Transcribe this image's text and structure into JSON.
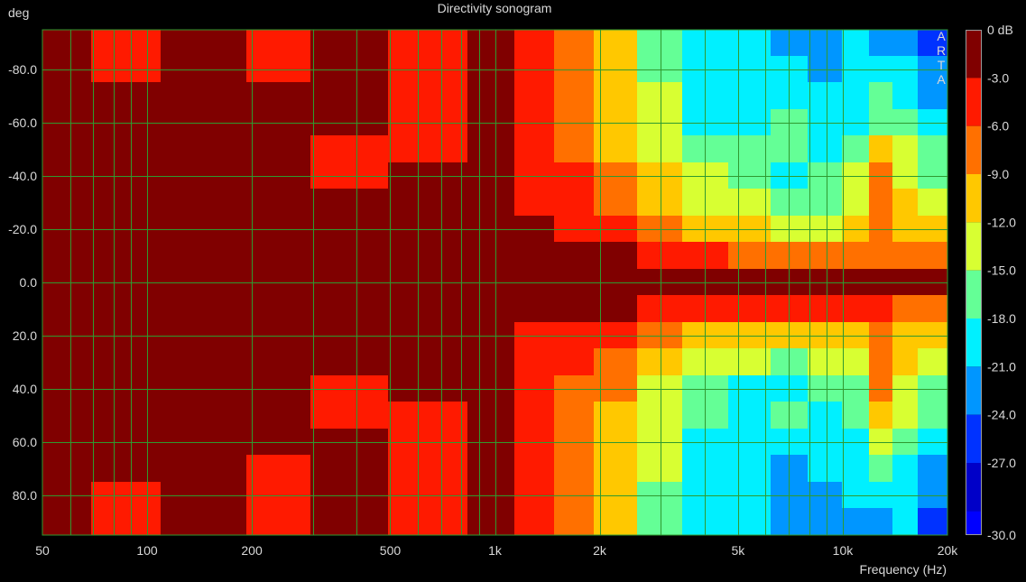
{
  "chart_data": {
    "type": "heatmap",
    "title": "Directivity sonogram",
    "ylabel": "deg",
    "xlabel": "Frequency (Hz)",
    "watermark": "ARTA",
    "x_scale": "log",
    "xlim": [
      50,
      20000
    ],
    "ylim": [
      -95,
      95
    ],
    "y_inverted": true,
    "grid": true,
    "x_ticks": [
      {
        "value": 50,
        "label": "50"
      },
      {
        "value": 100,
        "label": "100"
      },
      {
        "value": 200,
        "label": "200"
      },
      {
        "value": 500,
        "label": "500"
      },
      {
        "value": 1000,
        "label": "1k"
      },
      {
        "value": 2000,
        "label": "2k"
      },
      {
        "value": 5000,
        "label": "5k"
      },
      {
        "value": 10000,
        "label": "10k"
      },
      {
        "value": 20000,
        "label": "20k"
      }
    ],
    "y_ticks": [
      {
        "value": -80,
        "label": "-80.0"
      },
      {
        "value": -60,
        "label": "-60.0"
      },
      {
        "value": -40,
        "label": "-40.0"
      },
      {
        "value": -20,
        "label": "-20.0"
      },
      {
        "value": 0,
        "label": "0.0"
      },
      {
        "value": 20,
        "label": "20.0"
      },
      {
        "value": 40,
        "label": "40.0"
      },
      {
        "value": 60,
        "label": "60.0"
      },
      {
        "value": 80,
        "label": "80.0"
      }
    ],
    "colorbar": {
      "position": "right",
      "levels": [
        {
          "label": "0 dB",
          "from": 0,
          "to": -3,
          "color": "#800000"
        },
        {
          "label": "-3.0",
          "from": -3,
          "to": -6,
          "color": "#ff1a00"
        },
        {
          "label": "-6.0",
          "from": -6,
          "to": -9,
          "color": "#ff7000"
        },
        {
          "label": "-9.0",
          "from": -9,
          "to": -12,
          "color": "#ffc800"
        },
        {
          "label": "-12.0",
          "from": -12,
          "to": -15,
          "color": "#d8ff32"
        },
        {
          "label": "-15.0",
          "from": -15,
          "to": -18,
          "color": "#64ff96"
        },
        {
          "label": "-18.0",
          "from": -18,
          "to": -21,
          "color": "#00f0ff"
        },
        {
          "label": "-21.0",
          "from": -21,
          "to": -24,
          "color": "#0096ff"
        },
        {
          "label": "-24.0",
          "from": -24,
          "to": -27,
          "color": "#0032ff"
        },
        {
          "label": "-27.0",
          "from": -27,
          "to": -30,
          "color": "#0000c8"
        },
        {
          "label": "-30.0",
          "from": -30,
          "to": -33,
          "color": "#0000ff"
        }
      ]
    },
    "angles": [
      -90,
      -80,
      -70,
      -60,
      -50,
      -40,
      -30,
      -20,
      -10,
      0,
      10,
      20,
      30,
      40,
      50,
      60,
      70,
      80,
      90
    ],
    "frequencies": [
      60,
      80,
      150,
      250,
      350,
      700,
      1000,
      1300,
      1700,
      2200,
      3000,
      4000,
      5500,
      7000,
      9000,
      11000,
      13000,
      15000,
      18000
    ],
    "levels_db": [
      [
        -2,
        -4,
        -1,
        -4,
        -1,
        -4,
        -2,
        -4,
        -7,
        -10,
        -15,
        -20,
        -20,
        -21,
        -23,
        -20,
        -22,
        -21,
        -24
      ],
      [
        -2,
        -4,
        -1,
        -4,
        -1,
        -4,
        -2,
        -4,
        -7,
        -10,
        -15,
        -19,
        -19,
        -20,
        -22,
        -20,
        -19,
        -20,
        -23
      ],
      [
        -1,
        -1,
        -1,
        -1,
        -1,
        -4,
        -2,
        -4,
        -7,
        -10,
        -14,
        -19,
        -19,
        -19,
        -20,
        -19,
        -17,
        -19,
        -21
      ],
      [
        -1,
        -1,
        -1,
        -1,
        -1,
        -4,
        -2,
        -4,
        -7,
        -10,
        -14,
        -18,
        -18,
        -17,
        -19,
        -18,
        -15,
        -17,
        -19
      ],
      [
        -1,
        -1,
        -1,
        -1,
        -4,
        -4,
        -2,
        -4,
        -6,
        -9,
        -13,
        -17,
        -16,
        -16,
        -18,
        -16,
        -10,
        -14,
        -17
      ],
      [
        -1,
        -1,
        -1,
        -1,
        -4,
        -2,
        -1,
        -3,
        -5,
        -8,
        -11,
        -14,
        -16,
        -18,
        -17,
        -14,
        -7,
        -12,
        -15
      ],
      [
        -1,
        -1,
        -1,
        -1,
        -1,
        -1,
        -1,
        -3,
        -5,
        -7,
        -10,
        -12,
        -14,
        -16,
        -15,
        -12,
        -6,
        -10,
        -12
      ],
      [
        -1,
        -1,
        -1,
        -1,
        -1,
        -1,
        -1,
        -2,
        -3,
        -5,
        -8,
        -10,
        -11,
        -12,
        -12,
        -11,
        -8,
        -9,
        -10
      ],
      [
        -1,
        -1,
        -1,
        -1,
        -1,
        -1,
        -1,
        -1,
        -2,
        -2,
        -3,
        -5,
        -6,
        -7,
        -7,
        -6,
        -6,
        -6,
        -7
      ],
      [
        -1,
        -1,
        -1,
        -1,
        -1,
        -1,
        -1,
        -1,
        -1,
        -1,
        -1,
        -1,
        -1,
        -2,
        -1,
        -1,
        -2,
        -2,
        -2
      ],
      [
        -1,
        -1,
        -1,
        -1,
        -1,
        -1,
        -1,
        -1,
        -2,
        -2,
        -3,
        -5,
        -5,
        -5,
        -5,
        -4,
        -5,
        -6,
        -6
      ],
      [
        -1,
        -1,
        -1,
        -1,
        -1,
        -1,
        -1,
        -3,
        -4,
        -5,
        -8,
        -10,
        -10,
        -10,
        -10,
        -9,
        -8,
        -10,
        -10
      ],
      [
        -1,
        -1,
        -1,
        -1,
        -1,
        -1,
        -1,
        -3,
        -5,
        -7,
        -10,
        -12,
        -14,
        -15,
        -14,
        -12,
        -6,
        -11,
        -12
      ],
      [
        -1,
        -1,
        -1,
        -1,
        -4,
        -1,
        -1,
        -3,
        -6,
        -8,
        -12,
        -16,
        -18,
        -18,
        -17,
        -15,
        -7,
        -13,
        -15
      ],
      [
        -1,
        -1,
        -1,
        -1,
        -4,
        -4,
        -2,
        -4,
        -6,
        -9,
        -13,
        -17,
        -18,
        -16,
        -18,
        -16,
        -10,
        -14,
        -17
      ],
      [
        -1,
        -1,
        -1,
        -1,
        -1,
        -4,
        -2,
        -4,
        -7,
        -10,
        -14,
        -18,
        -19,
        -19,
        -20,
        -18,
        -14,
        -17,
        -19
      ],
      [
        -1,
        -1,
        -1,
        -4,
        -1,
        -4,
        -2,
        -4,
        -7,
        -10,
        -14,
        -19,
        -20,
        -21,
        -20,
        -19,
        -16,
        -18,
        -21
      ],
      [
        -2,
        -4,
        -1,
        -4,
        -1,
        -4,
        -2,
        -4,
        -7,
        -10,
        -15,
        -19,
        -20,
        -21,
        -22,
        -20,
        -18,
        -20,
        -23
      ],
      [
        -2,
        -4,
        -1,
        -4,
        -1,
        -4,
        -2,
        -4,
        -7,
        -10,
        -15,
        -20,
        -20,
        -22,
        -23,
        -21,
        -21,
        -20,
        -24
      ]
    ]
  }
}
